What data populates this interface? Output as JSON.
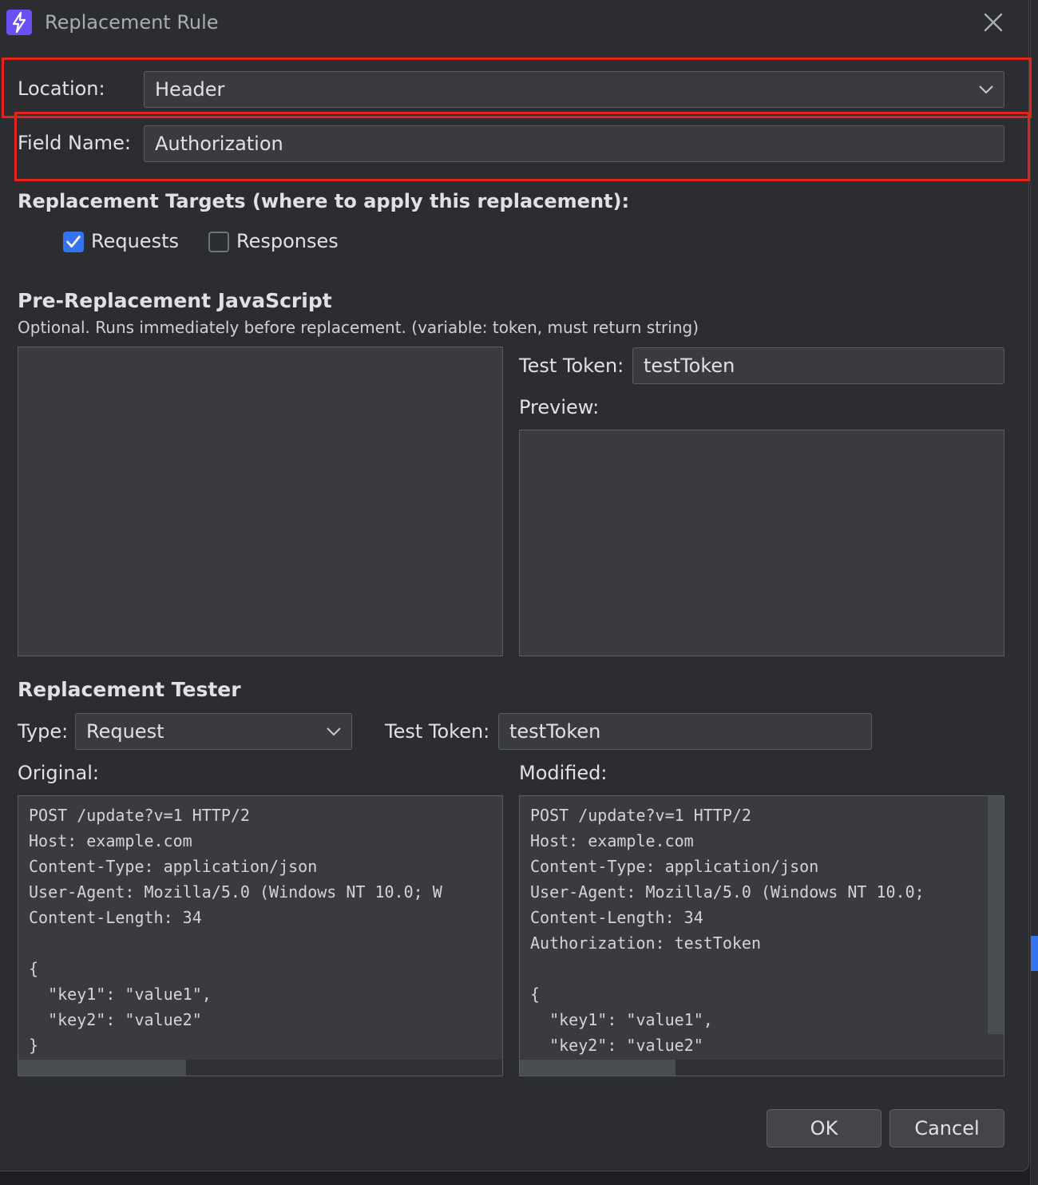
{
  "dialog": {
    "title": "Replacement Rule",
    "icon": "lightning-icon",
    "accent_color": "#3574f0",
    "highlight_color": "#e3241b"
  },
  "location": {
    "label": "Location:",
    "value": "Header"
  },
  "field_name": {
    "label": "Field Name:",
    "value": "Authorization"
  },
  "targets": {
    "heading": "Replacement Targets (where to apply this replacement):",
    "requests": {
      "label": "Requests",
      "checked": true
    },
    "responses": {
      "label": "Responses",
      "checked": false
    }
  },
  "pre_js": {
    "heading": "Pre-Replacement JavaScript",
    "description": "Optional. Runs immediately before replacement. (variable: token, must return string)",
    "code": "",
    "test_token_label": "Test Token:",
    "test_token_value": "testToken",
    "preview_label": "Preview:",
    "preview_value": ""
  },
  "tester": {
    "heading": "Replacement Tester",
    "type_label": "Type:",
    "type_value": "Request",
    "test_token_label": "Test Token:",
    "test_token_value": "testToken",
    "original_label": "Original:",
    "modified_label": "Modified:",
    "original_text": "POST /update?v=1 HTTP/2\nHost: example.com\nContent-Type: application/json\nUser-Agent: Mozilla/5.0 (Windows NT 10.0; W\nContent-Length: 34\n\n{\n  \"key1\": \"value1\",\n  \"key2\": \"value2\"\n}",
    "modified_text": "POST /update?v=1 HTTP/2\nHost: example.com\nContent-Type: application/json\nUser-Agent: Mozilla/5.0 (Windows NT 10.0;\nContent-Length: 34\nAuthorization: testToken\n\n{\n  \"key1\": \"value1\",\n  \"key2\": \"value2\""
  },
  "buttons": {
    "ok": "OK",
    "cancel": "Cancel"
  }
}
